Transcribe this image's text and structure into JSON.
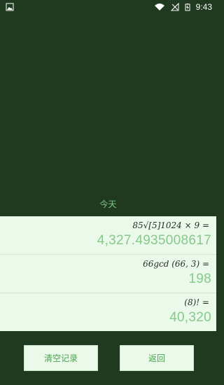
{
  "status": {
    "time": "9:43",
    "icons": [
      "image-icon",
      "wifi-icon",
      "signal-off-icon",
      "battery-charging-icon"
    ]
  },
  "section": {
    "today_label": "今天"
  },
  "history": [
    {
      "expression": "85√[5]1024 × 9 =",
      "result": "4,327.4935008617"
    },
    {
      "expression": "66gcd (66, 3) =",
      "result": "198"
    },
    {
      "expression": "(8)! =",
      "result": "40,320"
    }
  ],
  "buttons": {
    "clear": "清空记录",
    "back": "返回"
  },
  "colors": {
    "background": "#1f3a1f",
    "panel": "#eaf9ea",
    "accent": "#86c98a"
  }
}
